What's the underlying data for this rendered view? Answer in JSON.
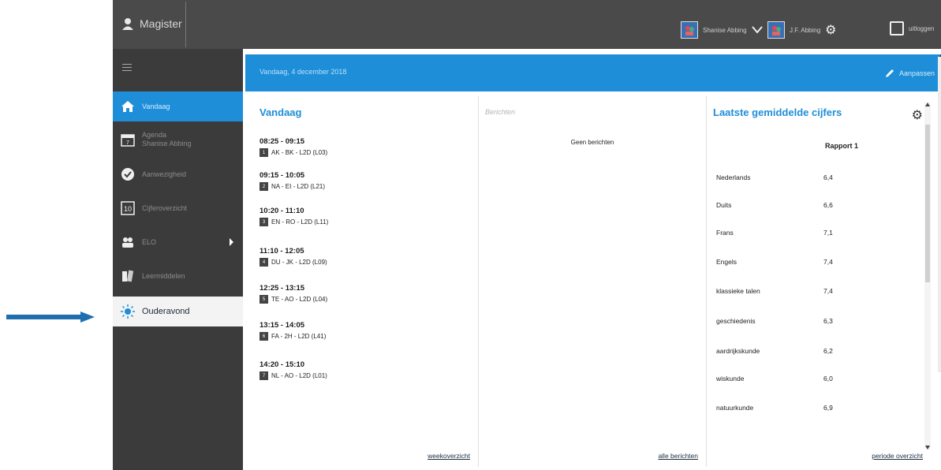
{
  "app": {
    "name": "Magister"
  },
  "topbar": {
    "user_primary": "Shanise Abbing",
    "user_secondary": "J.F. Abbing",
    "logout_label": "uitloggen"
  },
  "sidebar": {
    "items": [
      {
        "label": "Vandaag",
        "icon": "home-icon"
      },
      {
        "label": "Agenda",
        "sublabel": "Shanise Abbing",
        "icon": "calendar-icon"
      },
      {
        "label": "Aanwezigheid",
        "icon": "check-icon"
      },
      {
        "label": "Cijferoverzicht",
        "icon": "grades-icon"
      },
      {
        "label": "ELO",
        "icon": "users-icon"
      },
      {
        "label": "Leermiddelen",
        "icon": "books-icon"
      },
      {
        "label": "Ouderavond",
        "icon": "lightbulb-icon"
      }
    ],
    "calendar_day": "7",
    "grades_number": "10"
  },
  "main": {
    "header_title": "Vandaag, 4 december 2018",
    "edit_label": "Aanpassen"
  },
  "vandaag": {
    "title": "Vandaag",
    "lessons": [
      {
        "time": "08:25 - 09:15",
        "num": "1",
        "subject": "AK - BK - L2D (L03)"
      },
      {
        "time": "09:15 - 10:05",
        "num": "2",
        "subject": "NA - EI - L2D (L21)"
      },
      {
        "time": "10:20 - 11:10",
        "num": "3",
        "subject": "EN - RO - L2D (L11)"
      },
      {
        "time": "11:10 - 12:05",
        "num": "4",
        "subject": "DU - JK - L2D (L09)"
      },
      {
        "time": "12:25 - 13:15",
        "num": "5",
        "subject": "TE - AO - L2D (L04)"
      },
      {
        "time": "13:15 - 14:05",
        "num": "6",
        "subject": "FA - 2H - L2D (L41)"
      },
      {
        "time": "14:20 - 15:10",
        "num": "7",
        "subject": "NL - AO - L2D (L01)"
      }
    ],
    "footer_link": "weekoverzicht"
  },
  "berichten": {
    "title": "Berichten",
    "empty_text": "Geen berichten",
    "footer_link": "alle berichten"
  },
  "cijfers": {
    "title": "Laatste gemiddelde cijfers",
    "column_header": "Rapport 1",
    "rows": [
      {
        "subject": "Nederlands",
        "value": "6,4"
      },
      {
        "subject": "Duits",
        "value": "6,6"
      },
      {
        "subject": "Frans",
        "value": "7,1"
      },
      {
        "subject": "Engels",
        "value": "7,4"
      },
      {
        "subject": "klassieke talen",
        "value": "7,4"
      },
      {
        "subject": "geschiedenis",
        "value": "6,3"
      },
      {
        "subject": "aardrijkskunde",
        "value": "6,2"
      },
      {
        "subject": "wiskunde",
        "value": "6,0"
      },
      {
        "subject": "natuurkunde",
        "value": "6,9"
      }
    ],
    "footer_link": "periode overzicht"
  },
  "colors": {
    "accent_blue": "#1e8ed8",
    "sidebar_bg": "#3b3b3b",
    "topbar_bg": "#4a4a4a",
    "pointer_arrow": "#1f6fb0"
  }
}
